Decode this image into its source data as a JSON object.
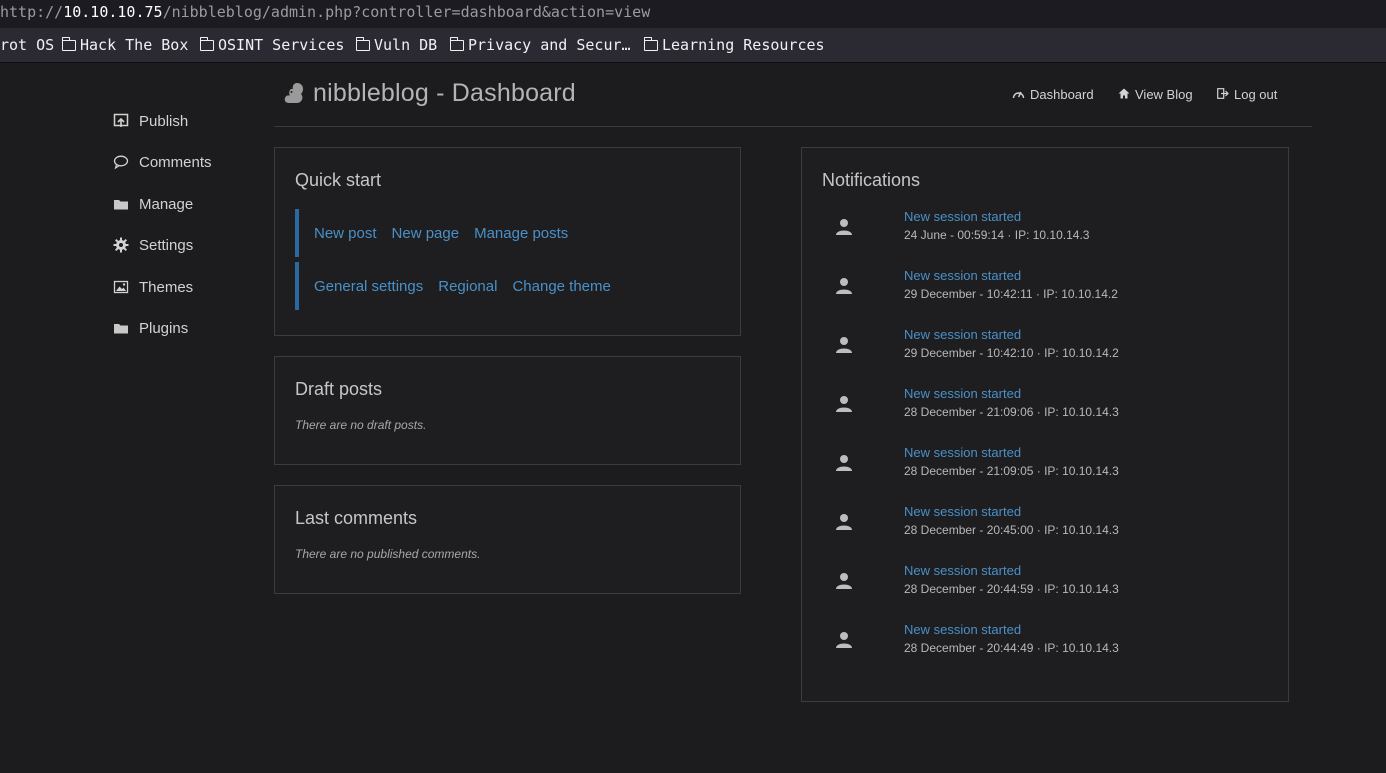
{
  "browser": {
    "url_prefix": "http://",
    "url_host": "10.10.10.75",
    "url_path": "/nibbleblog/admin.php?controller=dashboard&action=view",
    "bookmarks": [
      {
        "label": "rot OS",
        "icon": "none"
      },
      {
        "label": "Hack The Box",
        "icon": "folder-icon"
      },
      {
        "label": "OSINT Services",
        "icon": "folder-icon"
      },
      {
        "label": "Vuln DB",
        "icon": "folder-icon"
      },
      {
        "label": "Privacy and Secur…",
        "icon": "folder-icon"
      },
      {
        "label": "Learning Resources",
        "icon": "folder-icon"
      }
    ]
  },
  "header": {
    "title": "nibbleblog - Dashboard",
    "logo_icon": "squirrel-logo-icon",
    "nav": [
      {
        "label": "Dashboard",
        "icon": "gauge-icon"
      },
      {
        "label": "View Blog",
        "icon": "home-icon"
      },
      {
        "label": "Log out",
        "icon": "logout-icon"
      }
    ]
  },
  "sidebar": {
    "items": [
      {
        "label": "Publish",
        "icon": "publish-icon"
      },
      {
        "label": "Comments",
        "icon": "comment-icon"
      },
      {
        "label": "Manage",
        "icon": "folder-icon"
      },
      {
        "label": "Settings",
        "icon": "gear-icon"
      },
      {
        "label": "Themes",
        "icon": "image-icon"
      },
      {
        "label": "Plugins",
        "icon": "folder-icon"
      }
    ]
  },
  "quick_start": {
    "title": "Quick start",
    "rows": [
      [
        "New post",
        "New page",
        "Manage posts"
      ],
      [
        "General settings",
        "Regional",
        "Change theme"
      ]
    ]
  },
  "draft_posts": {
    "title": "Draft posts",
    "message": "There are no draft posts."
  },
  "last_comments": {
    "title": "Last comments",
    "message": "There are no published comments."
  },
  "notifications": {
    "title": "Notifications",
    "items": [
      {
        "title": "New session started",
        "meta": "24 June - 00:59:14 · IP: 10.10.14.3"
      },
      {
        "title": "New session started",
        "meta": "29 December - 10:42:11 · IP: 10.10.14.2"
      },
      {
        "title": "New session started",
        "meta": "29 December - 10:42:10 · IP: 10.10.14.2"
      },
      {
        "title": "New session started",
        "meta": "28 December - 21:09:06 · IP: 10.10.14.3"
      },
      {
        "title": "New session started",
        "meta": "28 December - 21:09:05 · IP: 10.10.14.3"
      },
      {
        "title": "New session started",
        "meta": "28 December - 20:45:00 · IP: 10.10.14.3"
      },
      {
        "title": "New session started",
        "meta": "28 December - 20:44:59 · IP: 10.10.14.3"
      },
      {
        "title": "New session started",
        "meta": "28 December - 20:44:49 · IP: 10.10.14.3"
      }
    ]
  },
  "colors": {
    "link": "#4a90c8",
    "accent_bar": "#2a6aa0",
    "background": "#1c1c1e"
  }
}
